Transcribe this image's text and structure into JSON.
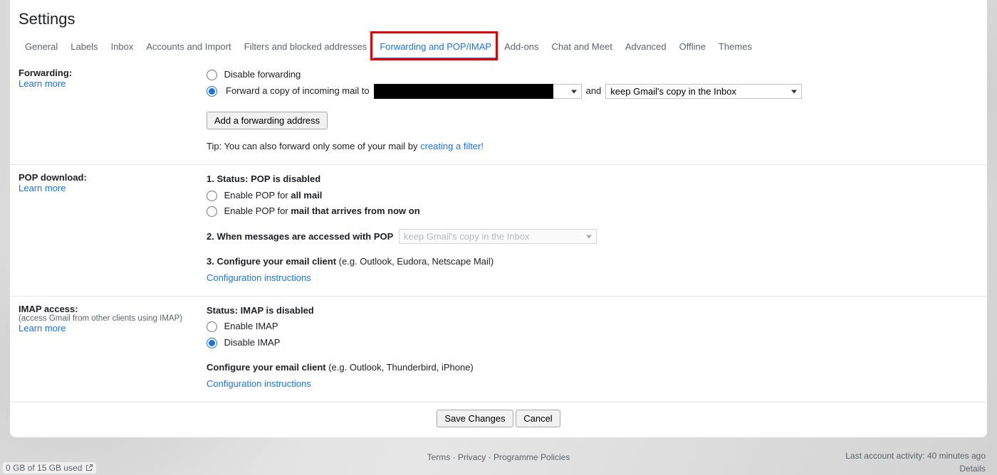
{
  "title": "Settings",
  "tabs": [
    "General",
    "Labels",
    "Inbox",
    "Accounts and Import",
    "Filters and blocked addresses",
    "Forwarding and POP/IMAP",
    "Add-ons",
    "Chat and Meet",
    "Advanced",
    "Offline",
    "Themes"
  ],
  "active_tab_index": 5,
  "forwarding": {
    "title": "Forwarding:",
    "learn_more": "Learn more",
    "disable_label": "Disable forwarding",
    "forward_label": "Forward a copy of incoming mail to",
    "and_text": "and",
    "action_select": "keep Gmail's copy in the Inbox",
    "add_button": "Add a forwarding address",
    "tip_prefix": "Tip: You can also forward only some of your mail by ",
    "tip_link": "creating a filter!"
  },
  "pop": {
    "title": "POP download:",
    "learn_more": "Learn more",
    "status_prefix": "1. Status: ",
    "status_value": "POP is disabled",
    "enable_all_prefix": "Enable POP for ",
    "enable_all_bold": "all mail",
    "enable_now_prefix": "Enable POP for ",
    "enable_now_bold": "mail that arrives from now on",
    "when_label": "2. When messages are accessed with POP",
    "when_select": "keep Gmail's copy in the Inbox",
    "configure_prefix": "3. Configure your email client ",
    "configure_eg": "(e.g. Outlook, Eudora, Netscape Mail)",
    "config_link": "Configuration instructions"
  },
  "imap": {
    "title": "IMAP access:",
    "sub": "(access Gmail from other clients using IMAP)",
    "learn_more": "Learn more",
    "status_prefix": "Status: ",
    "status_value": "IMAP is disabled",
    "enable_label": "Enable IMAP",
    "disable_label": "Disable IMAP",
    "configure_prefix": "Configure your email client ",
    "configure_eg": "(e.g. Outlook, Thunderbird, iPhone)",
    "config_link": "Configuration instructions"
  },
  "buttons": {
    "save": "Save Changes",
    "cancel": "Cancel"
  },
  "footer": {
    "terms": "Terms",
    "privacy": "Privacy",
    "policies": "Programme Policies",
    "activity": "Last account activity: 40 minutes ago",
    "details": "Details",
    "storage": "0 GB of 15 GB used"
  }
}
